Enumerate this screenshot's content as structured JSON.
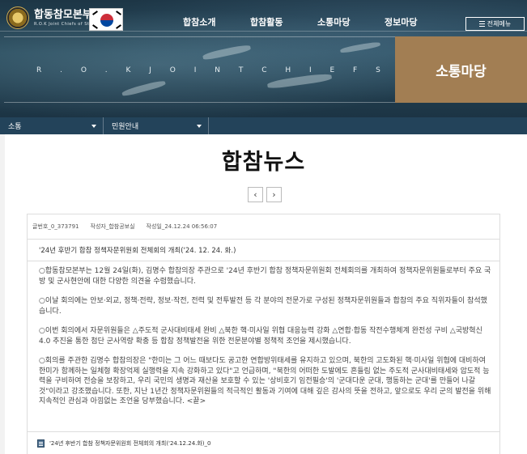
{
  "header": {
    "logo_title": "합동참모본부",
    "logo_subtitle": "R.O.K Joint Chiefs of Staff",
    "nav": [
      "합참소개",
      "합참활동",
      "소통마당",
      "정보마당"
    ],
    "all_menu_label": "전체메뉴",
    "motto": "R . O . K   J O I N T   C H I E F S   O F   S T A F F",
    "section_title": "소통마당"
  },
  "breadcrumb": {
    "level1": "소통",
    "level2": "민원안내"
  },
  "page": {
    "title": "합참뉴스",
    "prev_label": "‹",
    "next_label": "›"
  },
  "post": {
    "post_no": "글번호_0_373791",
    "author": "작성자_합참공보실",
    "date": "작성일_24.12.24 06:56:07",
    "subject": "'24년 후반기 합참 정책자문위원회 전체회의 개최('24. 12. 24. 화.)",
    "paragraphs": [
      "○합동참모본부는 12월 24일(화), 김명수 합참의장 주관으로 '24년 후반기 합참 정책자문위원회 전체회의를 개최하여 정책자문위원들로부터 주요 국방 및 군사현안에 대한 다양한 의견을 수렴했습니다.",
      "○이날 회의에는 안보·외교, 정책·전략, 정보·작전, 전력 및 전투발전 등 각 분야의 전문가로 구성된 정책자문위원들과 합참의 주요 직위자들이 참석했습니다.",
      "○이번 회의에서 자문위원들은 △주도적 군사대비태세 완비 △북한 핵·미사일 위협 대응능력 강화 △연합·합동 작전수행체계 완전성 구비 △국방혁신 4.0 추진을 통한 첨단 군사역량 확충 등 합참 정책발전을 위한 전문분야별 정책적 조언을 제시했습니다.",
      "○회의를 주관한 김명수 합참의장은 \"한미는 그 어느 때보다도 공고한 연합방위태세를 유지하고 있으며, 북한의 고도화된 핵·미사일 위협에 대비하여 한미가 함께하는 일체형 확장억제 실행력을 지속 강화하고 있다\"고 언급하며, \"북한의 어떠한 도발에도 흔들림 없는 주도적 군사대비태세와 압도적 능력을 구비하여 전승을 보장하고, 우리 국민의 생명과 재산을 보호할 수 있는 '상비호기 임전필승'의 '군대다운 군대, 행동하는 군대'를 만들어 나갈 것\"이라고 강조했습니다. 또한, 지난 1년간 정책자문위원들의 적극적인 활동과 기여에 대해 깊은 감사의 뜻을 전하고, 앞으로도 우리 군의 발전을 위해 지속적인 관심과 아낌없는 조언을 당부했습니다. <끝>"
    ],
    "attachment": "'24년 후반기 합참 정책자문위원회 전체회의 개최('24.12.24.화)_0"
  },
  "colors": {
    "section_box": "#a27e53",
    "breadcrumb_bar": "#23435a",
    "header_bg": "#284a5b"
  }
}
